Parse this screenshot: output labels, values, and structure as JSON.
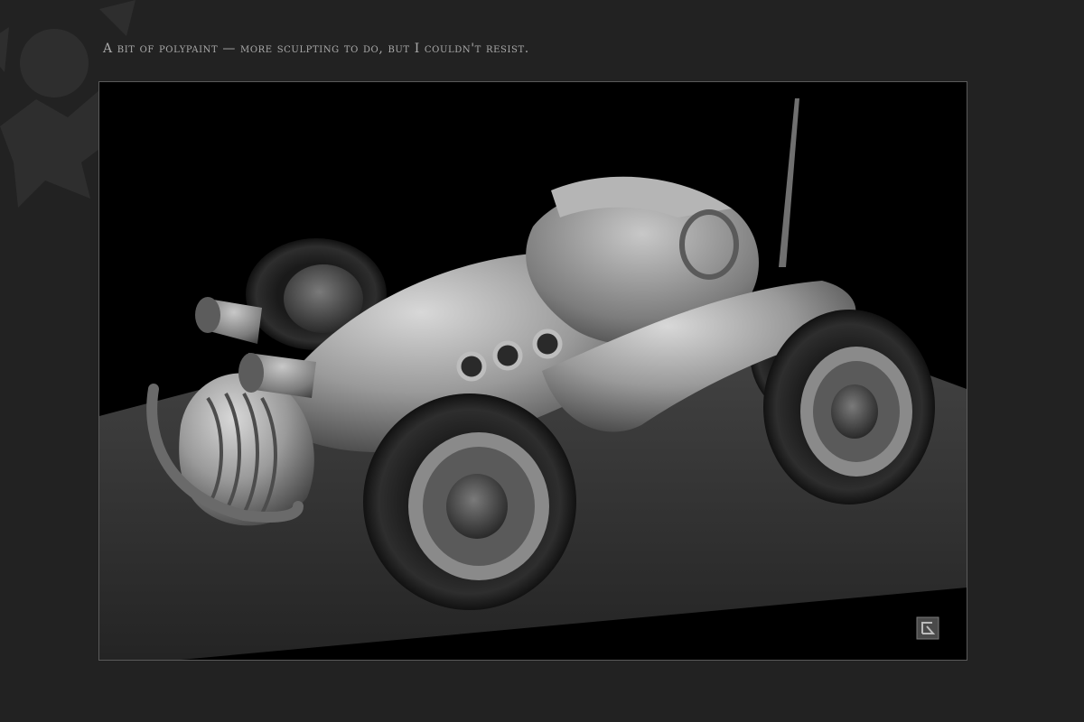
{
  "page": {
    "caption": "A bit of polypaint — more sculpting to do, but I couldn't resist."
  },
  "render": {
    "subject": "stylized toy race car sculpt",
    "colors": {
      "page_bg": "#222222",
      "viewport_bg": "#000000",
      "ground": "#3c3c3c",
      "caption": "#a9a9a9"
    }
  },
  "icons": {
    "background_ornament": "gear-splatter-ornament",
    "watermark": "artist-logo-icon"
  }
}
